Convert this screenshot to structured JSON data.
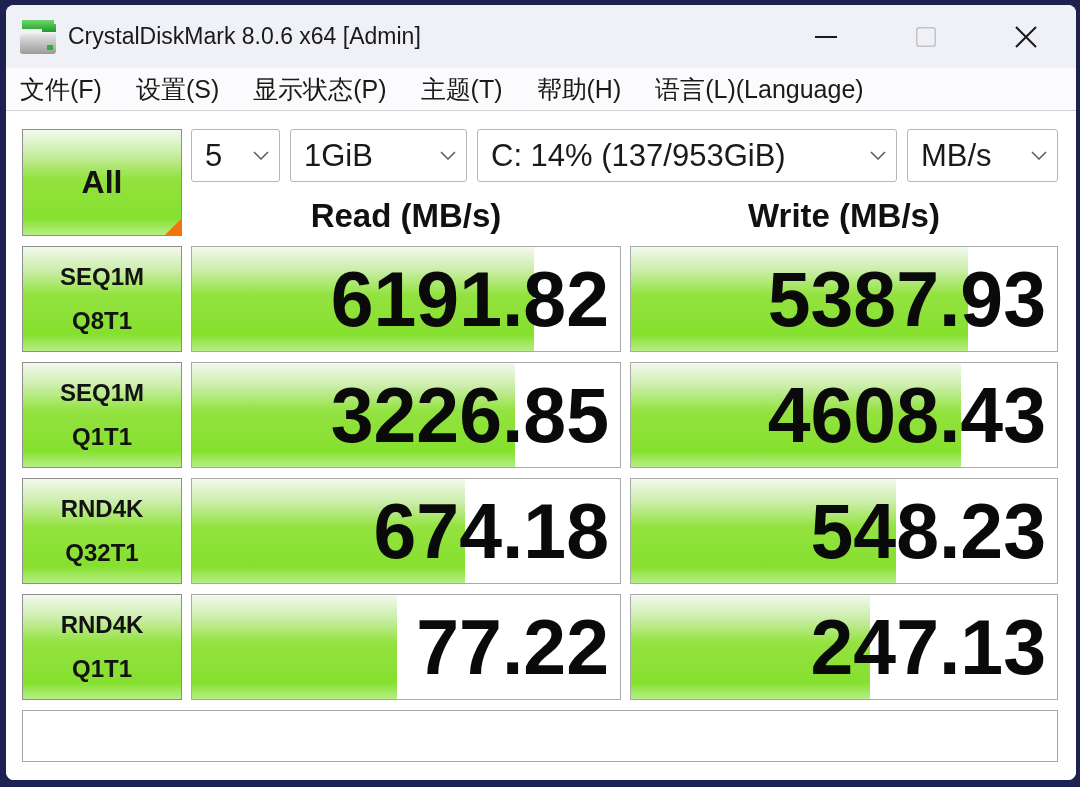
{
  "window": {
    "title": "CrystalDiskMark 8.0.6 x64 [Admin]",
    "maximize_disabled": true
  },
  "menu": [
    "文件(F)",
    "设置(S)",
    "显示状态(P)",
    "主题(T)",
    "帮助(H)",
    "语言(L)(Language)"
  ],
  "all_button": {
    "label": "All"
  },
  "settings": [
    {
      "value": "5"
    },
    {
      "value": "1GiB"
    },
    {
      "value": "C: 14% (137/953GiB)"
    },
    {
      "value": "MB/s"
    }
  ],
  "columns": [
    "Read (MB/s)",
    "Write (MB/s)"
  ],
  "tests": [
    {
      "name": "SEQ1M",
      "params": "Q8T1",
      "read": {
        "value": "6191.82",
        "level": 0.8
      },
      "write": {
        "value": "5387.93",
        "level": 0.79
      }
    },
    {
      "name": "SEQ1M",
      "params": "Q1T1",
      "read": {
        "value": "3226.85",
        "level": 0.754
      },
      "write": {
        "value": "4608.43",
        "level": 0.775
      }
    },
    {
      "name": "RND4K",
      "params": "Q32T1",
      "read": {
        "value": "674.18",
        "level": 0.637
      },
      "write": {
        "value": "548.23",
        "level": 0.623
      }
    },
    {
      "name": "RND4K",
      "params": "Q1T1",
      "read": {
        "value": "77.22",
        "level": 0.48
      },
      "write": {
        "value": "247.13",
        "level": 0.562
      }
    }
  ]
}
